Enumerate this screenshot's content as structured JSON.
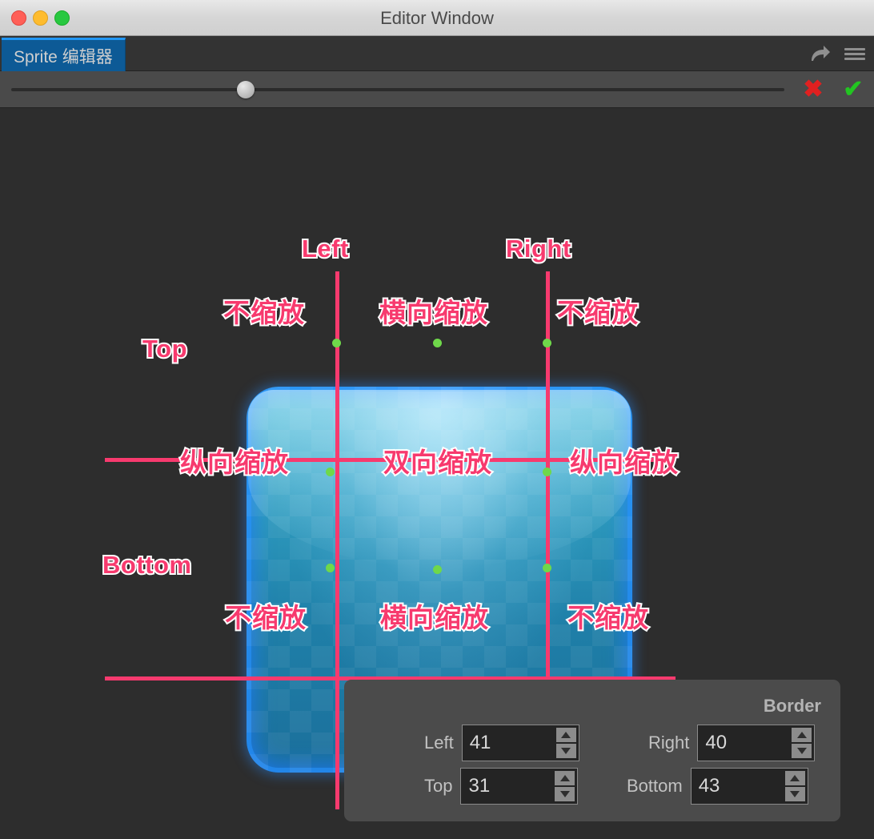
{
  "window": {
    "title": "Editor Window",
    "traffic_lights": [
      {
        "name": "close-button",
        "color": "#ff5f57"
      },
      {
        "name": "minimize-button",
        "color": "#febc2e"
      },
      {
        "name": "maximize-button",
        "color": "#28c840"
      }
    ]
  },
  "tabbar": {
    "tabs": [
      {
        "label": "Sprite 编辑器",
        "active": true
      }
    ],
    "actions": [
      {
        "name": "redo-icon",
        "icon": "redo-arrow-icon"
      },
      {
        "name": "menu-icon",
        "icon": "hamburger-menu-icon"
      }
    ]
  },
  "toolbar": {
    "zoom_slider": {
      "value_percent": 29
    },
    "cancel_label": "✖",
    "confirm_label": "✔"
  },
  "canvas": {
    "guide_labels": {
      "left": "Left",
      "right": "Right",
      "top": "Top",
      "bottom": "Bottom"
    },
    "region_labels": {
      "top_left": "不缩放",
      "top_center": "横向缩放",
      "top_right": "不缩放",
      "middle_left": "纵向缩放",
      "center": "双向缩放",
      "middle_right": "纵向缩放",
      "bottom_left": "不缩放",
      "bottom_center": "横向缩放",
      "bottom_right": "不缩放"
    },
    "colors": {
      "guide_pink": "#f73a6e",
      "handle_green": "#4ed23f",
      "background": "#2d2d2d"
    }
  },
  "border_panel": {
    "title": "Border",
    "fields": [
      {
        "label": "Left",
        "value": "41"
      },
      {
        "label": "Right",
        "value": "40"
      },
      {
        "label": "Top",
        "value": "31"
      },
      {
        "label": "Bottom",
        "value": "43"
      }
    ]
  }
}
